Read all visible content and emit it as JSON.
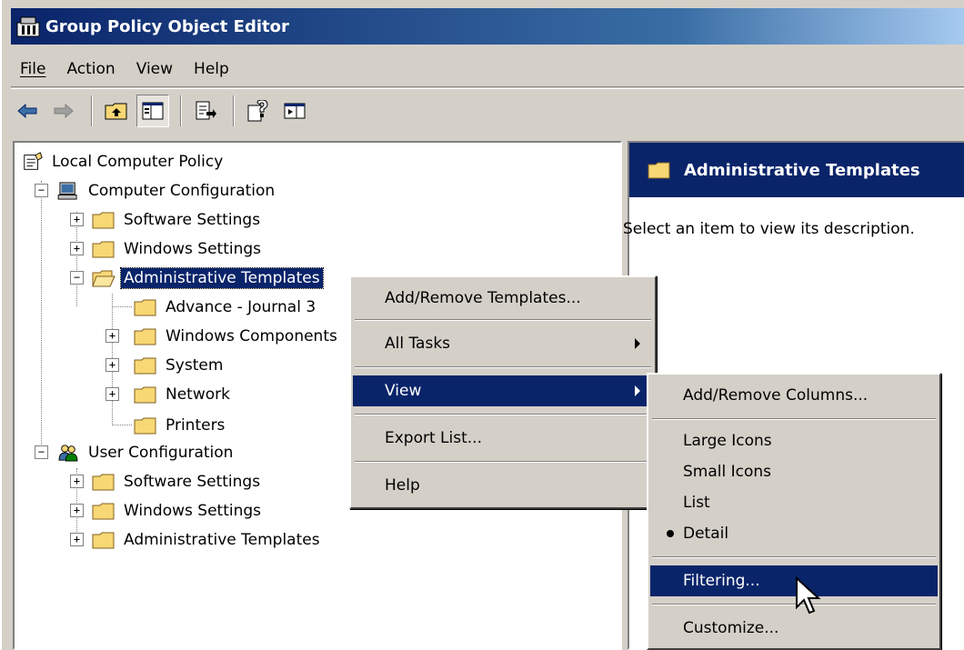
{
  "window": {
    "title": "Group Policy Object Editor"
  },
  "menu": {
    "file": "File",
    "action": "Action",
    "view": "View",
    "help": "Help"
  },
  "tree": {
    "root": "Local Computer Policy",
    "computer_config": "Computer Configuration",
    "cc_software": "Software Settings",
    "cc_windows": "Windows Settings",
    "cc_admin": "Administrative Templates",
    "advance": "Advance - Journal 3",
    "windows_components": "Windows Components",
    "system": "System",
    "network": "Network",
    "printers": "Printers",
    "user_config": "User Configuration",
    "uc_software": "Software Settings",
    "uc_windows": "Windows Settings",
    "uc_admin": "Administrative Templates"
  },
  "right_pane": {
    "header": "Administrative Templates",
    "description": "Select an item to view its description."
  },
  "context_menu": {
    "add_remove_templates": "Add/Remove Templates...",
    "all_tasks": "All Tasks",
    "view": "View",
    "export_list": "Export List...",
    "help": "Help"
  },
  "view_submenu": {
    "add_remove_columns": "Add/Remove Columns...",
    "large_icons": "Large Icons",
    "small_icons": "Small Icons",
    "list": "List",
    "detail": "Detail",
    "filtering": "Filtering...",
    "customize": "Customize..."
  },
  "colors": {
    "selection": "#0a246a",
    "face": "#d4d0c8",
    "folder": "#f8d775"
  }
}
